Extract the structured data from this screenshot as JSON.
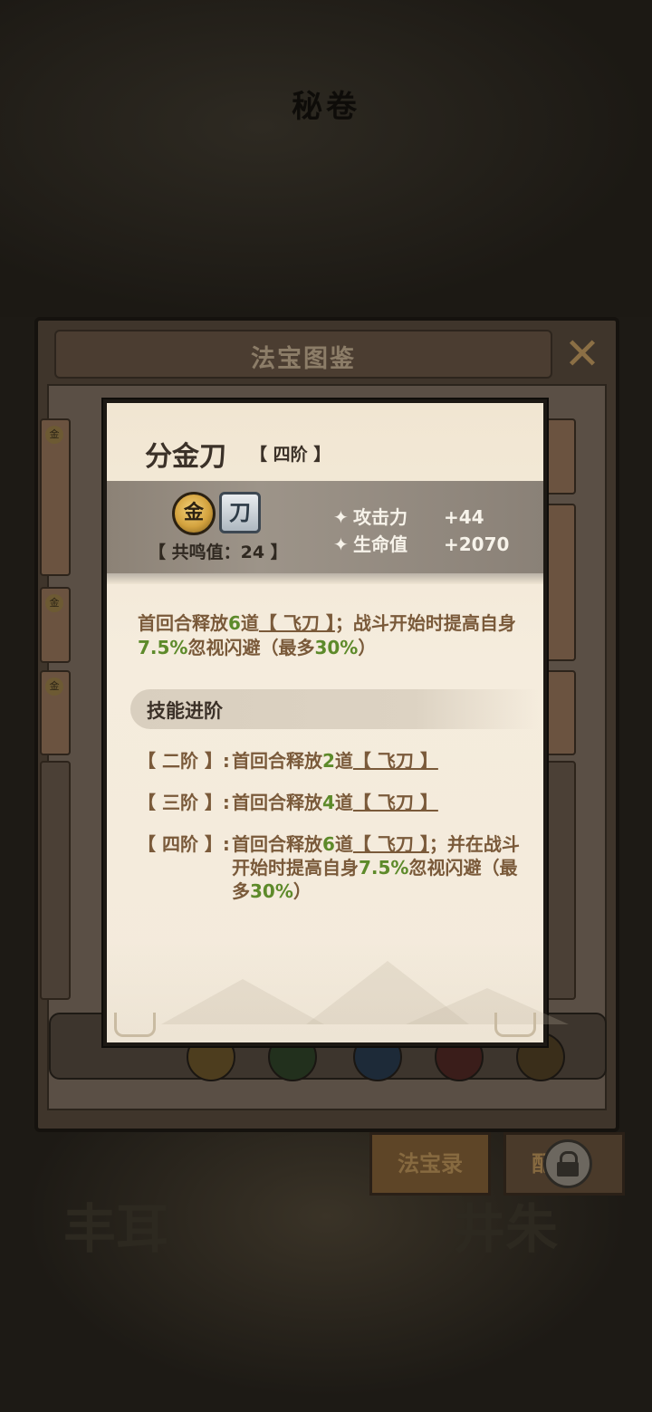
{
  "background": {
    "title": "秘卷",
    "bottom_left": "丰耳",
    "bottom_right": "井朱"
  },
  "catalog": {
    "title": "法宝图鉴",
    "close_icon": "close-x-icon",
    "tabs": [
      {
        "label": "法宝录"
      },
      {
        "label": "配"
      }
    ]
  },
  "card": {
    "name": "分金刀",
    "tier": "【 四阶 】",
    "element_glyph": "金",
    "weapon_glyph": "刀",
    "resonance": "【 共鸣值：24 】",
    "stats": [
      {
        "label": "攻击力",
        "value": "+44"
      },
      {
        "label": "生命值",
        "value": "+2070"
      }
    ],
    "description": {
      "p1": "首回合释放",
      "n1": "6",
      "p2": "道",
      "skill": "【 飞刀 】",
      "p3": "；战斗开始时提高自身",
      "n2": "7.5%",
      "p4": "忽视闪避（最多",
      "n3": "30%",
      "p5": "）"
    },
    "section_title": "技能进阶",
    "tiers": [
      {
        "label": "【 二阶 】:",
        "p1": "首回合释放",
        "n1": "2",
        "p2": "道",
        "skill": "【 飞刀 】",
        "p3": "",
        "n2": "",
        "p4": "",
        "n3": "",
        "p5": ""
      },
      {
        "label": "【 三阶 】:",
        "p1": "首回合释放",
        "n1": "4",
        "p2": "道",
        "skill": "【 飞刀 】",
        "p3": "",
        "n2": "",
        "p4": "",
        "n3": "",
        "p5": ""
      },
      {
        "label": "【 四阶 】:",
        "p1": "首回合释放",
        "n1": "6",
        "p2": "道",
        "skill": "【 飞刀 】",
        "p3": "；并在战斗开始时提高自身",
        "n2": "7.5%",
        "p4": "忽视闪避（最多",
        "n3": "30%",
        "p5": "）"
      }
    ],
    "colors": {
      "text_brown": "#7a5a3a",
      "highlight_green": "#5d8a2a",
      "title_dark": "#3b3128"
    }
  }
}
